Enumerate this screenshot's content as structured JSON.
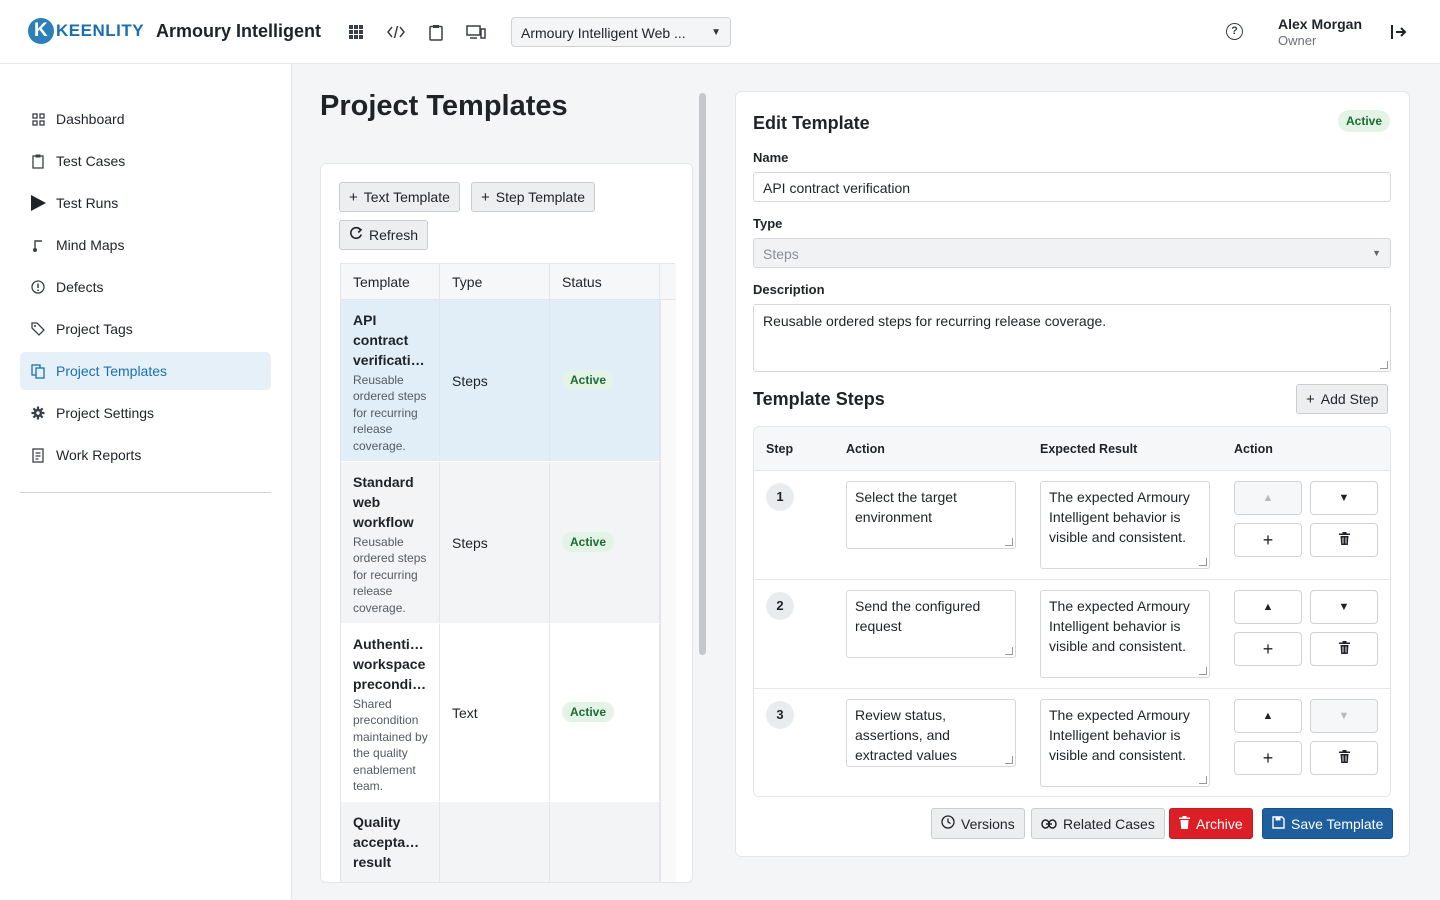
{
  "header": {
    "logo_text": "KEENLITY",
    "app_title": "Armoury Intelligent",
    "project_select": "Armoury Intelligent Web ...",
    "user_name": "Alex Morgan",
    "user_role": "Owner"
  },
  "sidebar": {
    "items": [
      {
        "label": "Dashboard",
        "icon": "grid-icon"
      },
      {
        "label": "Test Cases",
        "icon": "clipboard-icon"
      },
      {
        "label": "Test Runs",
        "icon": "play-icon"
      },
      {
        "label": "Mind Maps",
        "icon": "branch-icon"
      },
      {
        "label": "Defects",
        "icon": "alert-circle-icon"
      },
      {
        "label": "Project Tags",
        "icon": "tag-icon"
      },
      {
        "label": "Project Templates",
        "icon": "templates-icon",
        "active": true
      },
      {
        "label": "Project Settings",
        "icon": "gear-icon"
      },
      {
        "label": "Work Reports",
        "icon": "report-icon"
      }
    ]
  },
  "page": {
    "title": "Project Templates",
    "buttons": {
      "text_template": "Text Template",
      "step_template": "Step Template",
      "refresh": "Refresh"
    },
    "table": {
      "headers": [
        "Template",
        "Type",
        "Status"
      ],
      "rows": [
        {
          "name": "API contract verificati…",
          "description": "Reusable ordered steps for recurring release coverage.",
          "type": "Steps",
          "status": "Active"
        },
        {
          "name": "Standard web workflow",
          "description": "Reusable ordered steps for recurring release coverage.",
          "type": "Steps",
          "status": "Active"
        },
        {
          "name": "Authenti… workspace precondi…",
          "description": "Shared precondition maintained by the quality enablement team.",
          "type": "Text",
          "status": "Active"
        },
        {
          "name": "Quality accepta… result",
          "description": "",
          "type": "",
          "status": ""
        }
      ]
    }
  },
  "edit": {
    "title": "Edit Template",
    "status": "Active",
    "name_label": "Name",
    "name_value": "API contract verification",
    "type_label": "Type",
    "type_value": "Steps",
    "description_label": "Description",
    "description_value": "Reusable ordered steps for recurring release coverage.",
    "steps_title": "Template Steps",
    "add_step": "Add Step",
    "steps_headers": [
      "Step",
      "Action",
      "Expected Result",
      "Action"
    ],
    "steps": [
      {
        "num": "1",
        "action": "Select the target environment",
        "expected": "The expected Armoury Intelligent behavior is visible and consistent."
      },
      {
        "num": "2",
        "action": "Send the configured request",
        "expected": "The expected Armoury Intelligent behavior is visible and consistent."
      },
      {
        "num": "3",
        "action": "Review status, assertions, and extracted values",
        "expected": "The expected Armoury Intelligent behavior is visible and consistent."
      }
    ],
    "footer": {
      "versions": "Versions",
      "related_cases": "Related Cases",
      "archive": "Archive",
      "save": "Save Template"
    }
  },
  "colors": {
    "accent": "#1b6fb0",
    "active_badge_bg": "#e3f3e6",
    "active_badge_text": "#1d6b34",
    "archive": "#dc1f26",
    "save": "#1f5f9e"
  }
}
